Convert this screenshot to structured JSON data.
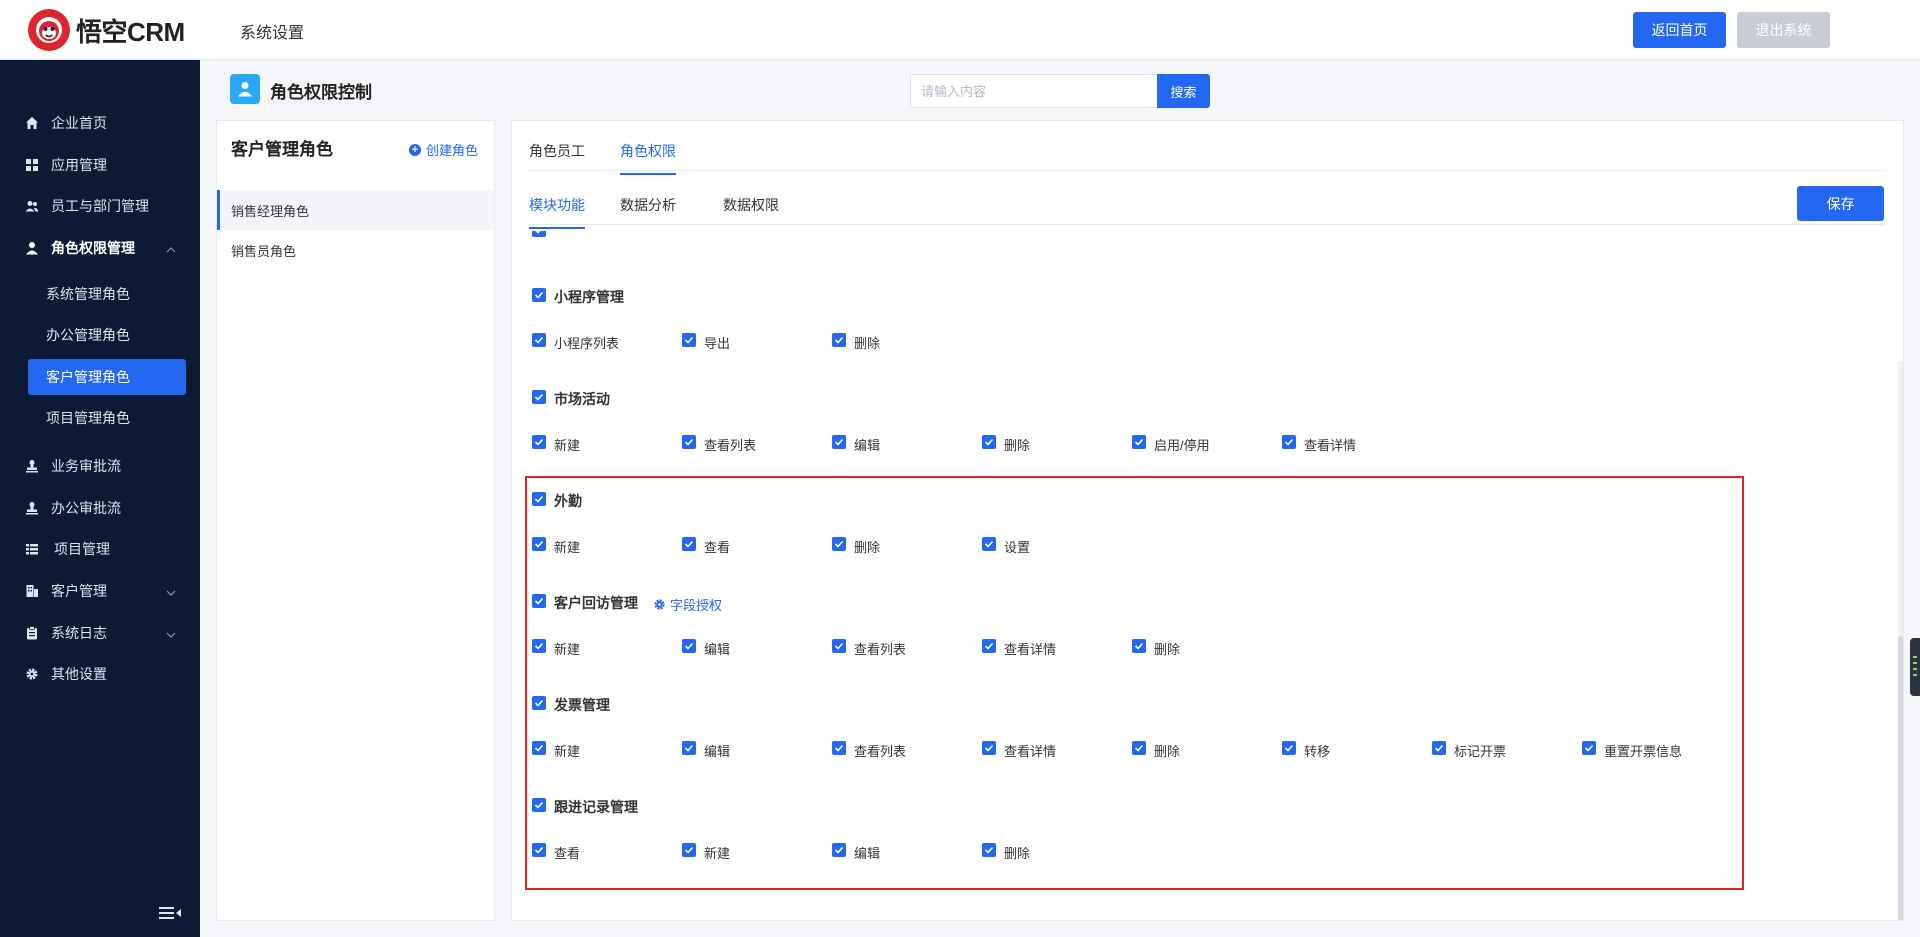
{
  "header": {
    "logo_text": "悟空CRM",
    "title": "系统设置",
    "home_button": "返回首页",
    "logout_button": "退出系统"
  },
  "sidebar": {
    "items": [
      {
        "label": "企业首页",
        "icon": "home-icon"
      },
      {
        "label": "应用管理",
        "icon": "grid-icon"
      },
      {
        "label": "员工与部门管理",
        "icon": "users-icon"
      },
      {
        "label": "角色权限管理",
        "icon": "user-icon",
        "expanded": true
      },
      {
        "label": "业务审批流",
        "icon": "stamp-icon"
      },
      {
        "label": "办公审批流",
        "icon": "stamp-icon"
      },
      {
        "label": "项目管理",
        "icon": "list-icon"
      },
      {
        "label": "客户管理",
        "icon": "building-icon",
        "expandable": true
      },
      {
        "label": "系统日志",
        "icon": "clipboard-icon",
        "expandable": true
      },
      {
        "label": "其他设置",
        "icon": "gear-icon"
      }
    ],
    "sub_items": [
      {
        "label": "系统管理角色",
        "active": false
      },
      {
        "label": "办公管理角色",
        "active": false
      },
      {
        "label": "客户管理角色",
        "active": true
      },
      {
        "label": "项目管理角色",
        "active": false
      }
    ]
  },
  "page": {
    "title": "角色权限控制",
    "search_placeholder": "请输入内容",
    "search_button": "搜索"
  },
  "role_panel": {
    "title": "客户管理角色",
    "create_label": "创建角色",
    "roles": [
      {
        "label": "销售经理角色",
        "active": true
      },
      {
        "label": "销售员角色",
        "active": false
      }
    ]
  },
  "main": {
    "tabs": [
      {
        "label": "角色员工",
        "active": false
      },
      {
        "label": "角色权限",
        "active": true
      }
    ],
    "subtabs": [
      {
        "label": "模块功能",
        "active": true
      },
      {
        "label": "数据分析",
        "active": false
      },
      {
        "label": "数据权限",
        "active": false
      }
    ],
    "save_button": "保存",
    "field_auth_label": "字段授权",
    "groups": [
      {
        "name": "小程序管理",
        "options": [
          "小程序列表",
          "导出",
          "删除"
        ]
      },
      {
        "name": "市场活动",
        "options": [
          "新建",
          "查看列表",
          "编辑",
          "删除",
          "启用/停用",
          "查看详情"
        ]
      },
      {
        "name": "外勤",
        "options": [
          "新建",
          "查看",
          "删除",
          "设置"
        ]
      },
      {
        "name": "客户回访管理",
        "field_auth": true,
        "options": [
          "新建",
          "编辑",
          "查看列表",
          "查看详情",
          "删除"
        ]
      },
      {
        "name": "发票管理",
        "options": [
          "新建",
          "编辑",
          "查看列表",
          "查看详情",
          "删除",
          "转移",
          "标记开票",
          "重置开票信息"
        ]
      },
      {
        "name": "跟进记录管理",
        "options": [
          "查看",
          "新建",
          "编辑",
          "删除"
        ]
      }
    ]
  },
  "colors": {
    "primary": "#2468f2",
    "sidebar_bg": "#0d1a36",
    "highlight": "#e8231a",
    "logo_red": "#d9262f"
  }
}
